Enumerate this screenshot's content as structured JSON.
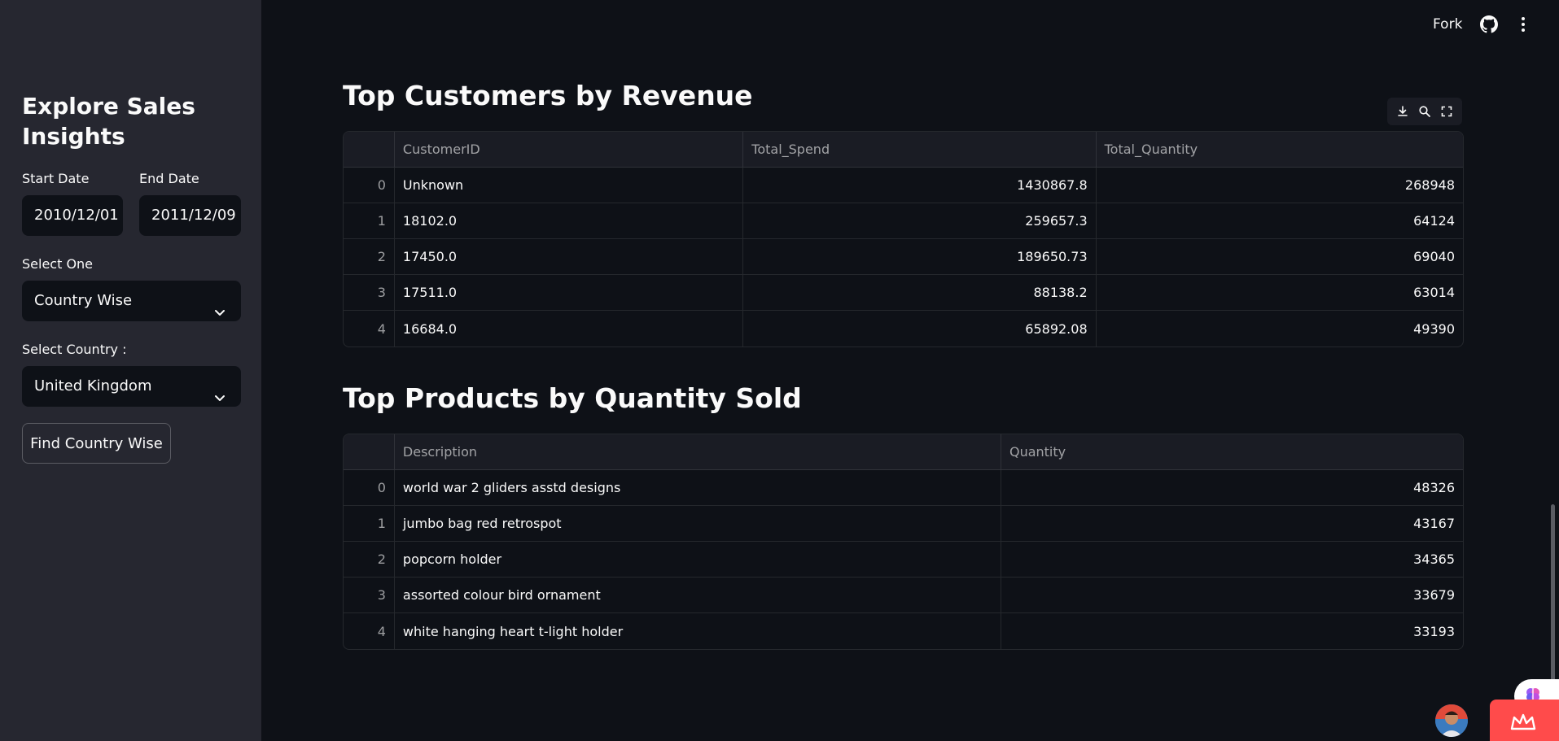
{
  "sidebar": {
    "title": "Explore Sales Insights",
    "start_date_label": "Start Date",
    "start_date_value": "2010/12/01",
    "end_date_label": "End Date",
    "end_date_value": "2011/12/09",
    "select_one_label": "Select One",
    "select_one_value": "Country Wise",
    "select_country_label": "Select Country :",
    "select_country_value": "United Kingdom",
    "find_button_label": "Find Country Wise"
  },
  "header": {
    "fork_label": "Fork",
    "icons": [
      "github-icon",
      "more-vertical-icon"
    ]
  },
  "customers": {
    "title": "Top Customers by Revenue",
    "toolbar_icons": [
      "download-icon",
      "search-icon",
      "fullscreen-icon"
    ],
    "columns": [
      "",
      "CustomerID",
      "Total_Spend",
      "Total_Quantity"
    ],
    "rows": [
      {
        "index": "0",
        "customer_id": "Unknown",
        "total_spend": "1430867.8",
        "total_quantity": "268948"
      },
      {
        "index": "1",
        "customer_id": "18102.0",
        "total_spend": "259657.3",
        "total_quantity": "64124"
      },
      {
        "index": "2",
        "customer_id": "17450.0",
        "total_spend": "189650.73",
        "total_quantity": "69040"
      },
      {
        "index": "3",
        "customer_id": "17511.0",
        "total_spend": "88138.2",
        "total_quantity": "63014"
      },
      {
        "index": "4",
        "customer_id": "16684.0",
        "total_spend": "65892.08",
        "total_quantity": "49390"
      }
    ]
  },
  "products": {
    "title": "Top Products by Quantity Sold",
    "columns": [
      "",
      "Description",
      "Quantity"
    ],
    "rows": [
      {
        "index": "0",
        "description": "world war 2 gliders asstd designs",
        "quantity": "48326"
      },
      {
        "index": "1",
        "description": "jumbo bag red retrospot",
        "quantity": "43167"
      },
      {
        "index": "2",
        "description": "popcorn holder",
        "quantity": "34365"
      },
      {
        "index": "3",
        "description": "assorted colour bird ornament",
        "quantity": "33679"
      },
      {
        "index": "4",
        "description": "white hanging heart t-light holder",
        "quantity": "33193"
      }
    ]
  },
  "colors": {
    "background": "#0e1117",
    "sidebar": "#262730",
    "accent": "#ff4b4b",
    "text": "#fafafa"
  }
}
